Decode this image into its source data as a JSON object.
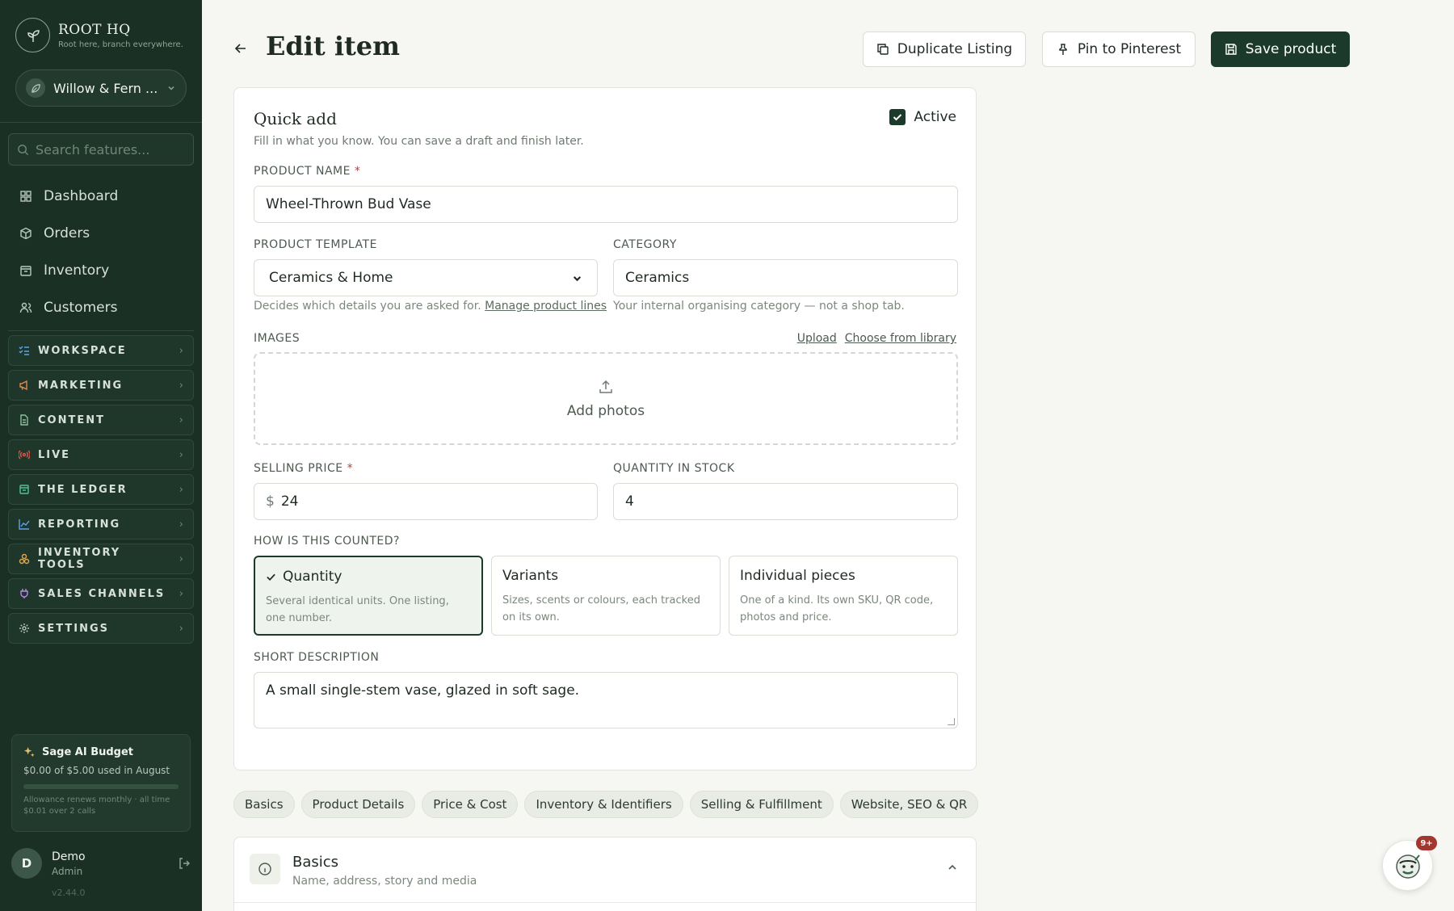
{
  "brand": {
    "name": "ROOT HQ",
    "tagline": "Root here, branch everywhere."
  },
  "store": {
    "name": "Willow & Fern ..."
  },
  "search": {
    "placeholder": "Search features..."
  },
  "nav": {
    "items": [
      {
        "label": "Dashboard",
        "icon": "dashboard-icon"
      },
      {
        "label": "Orders",
        "icon": "box-icon"
      },
      {
        "label": "Inventory",
        "icon": "inventory-icon"
      },
      {
        "label": "Customers",
        "icon": "users-icon"
      }
    ]
  },
  "groups": {
    "items": [
      {
        "label": "WORKSPACE",
        "icon": "checklist-icon",
        "color": "#5aa5e6"
      },
      {
        "label": "MARKETING",
        "icon": "megaphone-icon",
        "color": "#e08a4a"
      },
      {
        "label": "CONTENT",
        "icon": "document-icon",
        "color": "#8fbf9c"
      },
      {
        "label": "LIVE",
        "icon": "broadcast-icon",
        "color": "#e0564a"
      },
      {
        "label": "THE LEDGER",
        "icon": "ledger-icon",
        "color": "#4fc4a0"
      },
      {
        "label": "REPORTING",
        "icon": "chart-icon",
        "color": "#5aa5e6"
      },
      {
        "label": "INVENTORY TOOLS",
        "icon": "boxes-icon",
        "color": "#e0a84a"
      },
      {
        "label": "SALES CHANNELS",
        "icon": "plug-icon",
        "color": "#b58ae6"
      },
      {
        "label": "SETTINGS",
        "icon": "gear-icon",
        "color": "#b9c7bd"
      }
    ]
  },
  "budget": {
    "title": "Sage AI Budget",
    "used": "$0.00 of $5.00 used in August",
    "progress_fraction": 0.0,
    "note": "Allowance renews monthly · all time $0.01 over 2 calls"
  },
  "user": {
    "initial": "D",
    "name": "Demo",
    "role": "Admin",
    "version": "v2.44.0"
  },
  "header": {
    "title": "Edit item",
    "duplicate_label": "Duplicate Listing",
    "pin_label": "Pin to Pinterest",
    "save_label": "Save product"
  },
  "quick_add": {
    "title": "Quick add",
    "subtitle": "Fill in what you know. You can save a draft and finish later.",
    "active_label": "Active",
    "active_checked": true,
    "product_name_label": "PRODUCT NAME",
    "product_name_value": "Wheel-Thrown Bud Vase",
    "template_label": "PRODUCT TEMPLATE",
    "template_value": "Ceramics & Home",
    "template_helper": "Decides which details you are asked for.",
    "template_helper_link": "Manage product lines",
    "category_label": "CATEGORY",
    "category_value": "Ceramics",
    "category_helper": "Your internal organising category — not a shop tab.",
    "images_label": "IMAGES",
    "upload_link": "Upload",
    "library_link": "Choose from library",
    "add_photos": "Add photos",
    "price_label": "SELLING PRICE",
    "currency": "$",
    "price_value": "24",
    "qty_label": "QUANTITY IN STOCK",
    "qty_value": "4",
    "counted_label": "HOW IS THIS COUNTED?",
    "options": [
      {
        "title": "Quantity",
        "desc": "Several identical units. One listing, one number.",
        "selected": true
      },
      {
        "title": "Variants",
        "desc": "Sizes, scents or colours, each tracked on its own.",
        "selected": false
      },
      {
        "title": "Individual pieces",
        "desc": "One of a kind. Its own SKU, QR code, photos and price.",
        "selected": false
      }
    ],
    "short_desc_label": "SHORT DESCRIPTION",
    "short_desc_value": "A small single-stem vase, glazed in soft sage."
  },
  "chips": [
    "Basics",
    "Product Details",
    "Price & Cost",
    "Inventory & Identifiers",
    "Selling & Fulfillment",
    "Website, SEO & QR"
  ],
  "section": {
    "title": "Basics",
    "subtitle": "Name, address, story and media"
  },
  "chat": {
    "badge": "9+"
  }
}
